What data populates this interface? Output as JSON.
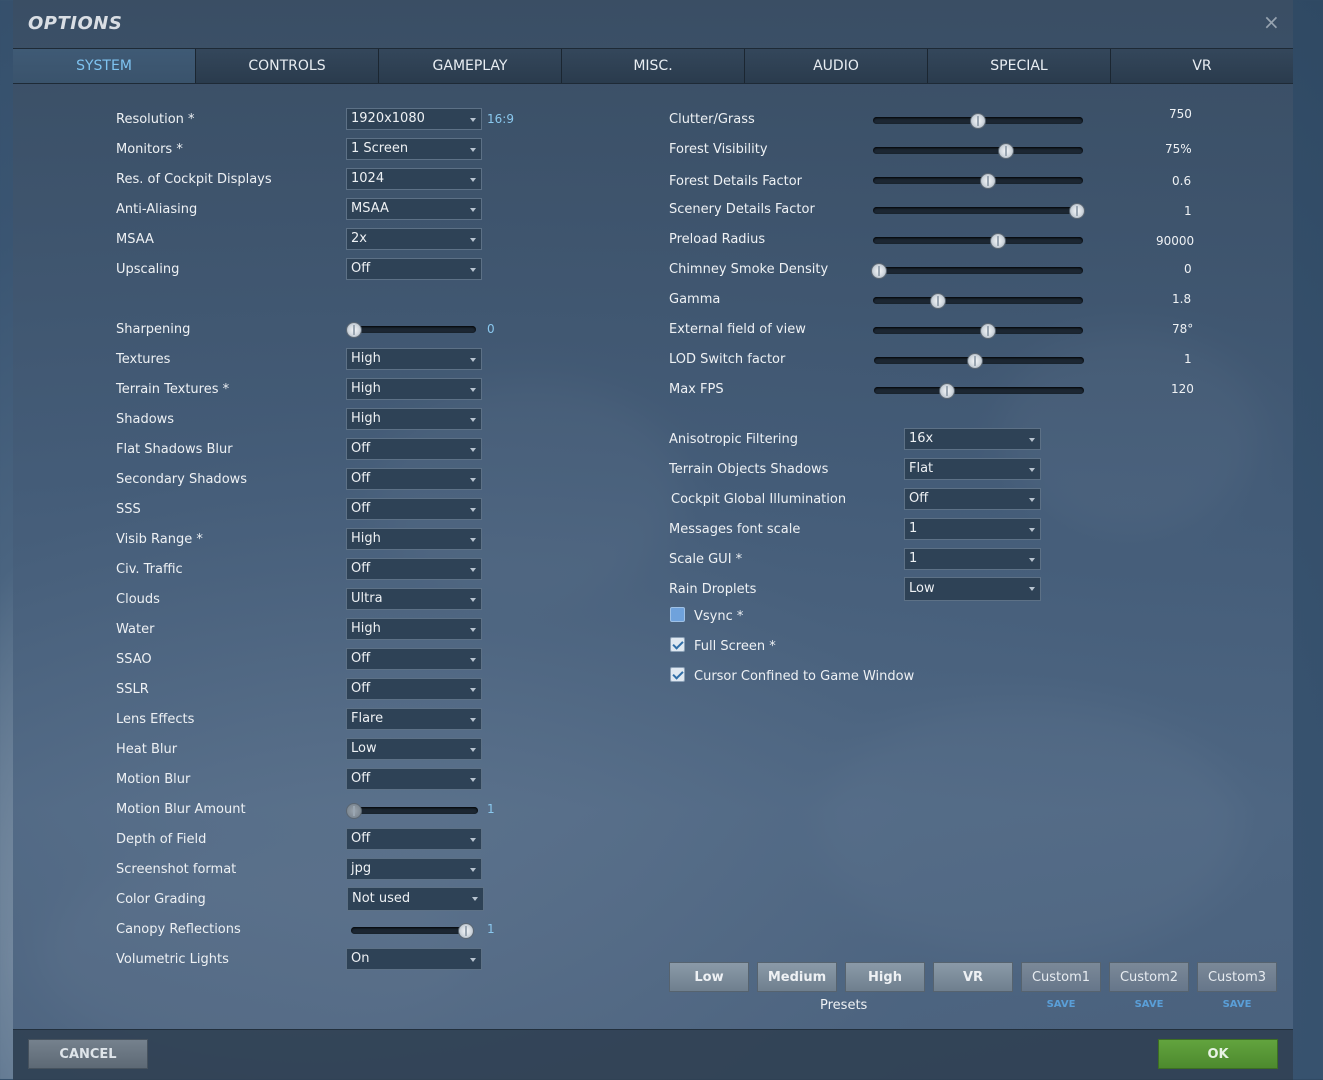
{
  "window": {
    "title": "OPTIONS"
  },
  "tabs": [
    "SYSTEM",
    "CONTROLS",
    "GAMEPLAY",
    "MISC.",
    "AUDIO",
    "SPECIAL",
    "VR"
  ],
  "active_tab": "SYSTEM",
  "left": {
    "resolution": {
      "label": "Resolution *",
      "value": "1920x1080",
      "aspect": "16:9"
    },
    "monitors": {
      "label": "Monitors *",
      "value": "1 Screen"
    },
    "cockpit_res": {
      "label": "Res. of Cockpit Displays",
      "value": "1024"
    },
    "anti_aliasing": {
      "label": "Anti-Aliasing",
      "value": "MSAA"
    },
    "msaa": {
      "label": "MSAA",
      "value": "2x"
    },
    "upscaling": {
      "label": "Upscaling",
      "value": "Off"
    },
    "sharpening": {
      "label": "Sharpening",
      "value": "0",
      "fraction": 0.0
    },
    "textures": {
      "label": "Textures",
      "value": "High"
    },
    "terrain_textures": {
      "label": "Terrain Textures *",
      "value": "High"
    },
    "shadows": {
      "label": "Shadows",
      "value": "High"
    },
    "flat_shadows_blur": {
      "label": "Flat Shadows Blur",
      "value": "Off"
    },
    "secondary_shadows": {
      "label": "Secondary Shadows",
      "value": "Off"
    },
    "sss": {
      "label": "SSS",
      "value": "Off"
    },
    "visib_range": {
      "label": "Visib Range *",
      "value": "High"
    },
    "civ_traffic": {
      "label": "Civ. Traffic",
      "value": "Off"
    },
    "clouds": {
      "label": "Clouds",
      "value": "Ultra"
    },
    "water": {
      "label": "Water",
      "value": "High"
    },
    "ssao": {
      "label": "SSAO",
      "value": "Off"
    },
    "sslr": {
      "label": "SSLR",
      "value": "Off"
    },
    "lens_effects": {
      "label": "Lens Effects",
      "value": "Flare"
    },
    "heat_blur": {
      "label": "Heat Blur",
      "value": "Low"
    },
    "motion_blur": {
      "label": "Motion Blur",
      "value": "Off"
    },
    "motion_blur_amount": {
      "label": "Motion Blur Amount",
      "value": "1",
      "fraction": 0.0
    },
    "depth_of_field": {
      "label": "Depth of Field",
      "value": "Off"
    },
    "screenshot_format": {
      "label": "Screenshot format",
      "value": "jpg"
    },
    "color_grading": {
      "label": "Color Grading",
      "value": "Not used"
    },
    "canopy_reflections": {
      "label": "Canopy Reflections",
      "value": "1",
      "fraction": 1.0
    },
    "volumetric_lights": {
      "label": "Volumetric Lights",
      "value": "On"
    }
  },
  "right": {
    "clutter": {
      "label": "Clutter/Grass",
      "value": "750",
      "fraction": 0.5
    },
    "forest_visibility": {
      "label": "Forest Visibility",
      "value": "75%",
      "fraction": 0.64
    },
    "forest_details": {
      "label": "Forest Details Factor",
      "value": "0.6",
      "fraction": 0.55
    },
    "scenery_details": {
      "label": "Scenery Details Factor",
      "value": "1",
      "fraction": 1.0
    },
    "preload_radius": {
      "label": "Preload Radius",
      "value": "90000",
      "fraction": 0.6
    },
    "chimney_smoke": {
      "label": "Chimney Smoke Density",
      "value": "0",
      "fraction": 0.0
    },
    "gamma": {
      "label": "Gamma",
      "value": "1.8",
      "fraction": 0.3
    },
    "external_fov": {
      "label": "External field of view",
      "value": "78°",
      "fraction": 0.55
    },
    "lod_switch": {
      "label": "LOD Switch factor",
      "value": "1",
      "fraction": 0.48
    },
    "max_fps": {
      "label": "Max FPS",
      "value": "120",
      "fraction": 0.34
    },
    "anisotropic": {
      "label": "Anisotropic Filtering",
      "value": "16x"
    },
    "terrain_object_shadows": {
      "label": "Terrain Objects Shadows",
      "value": "Flat"
    },
    "cockpit_gi": {
      "label": "Cockpit Global Illumination",
      "value": "Off"
    },
    "messages_font_scale": {
      "label": "Messages font scale",
      "value": "1"
    },
    "scale_gui": {
      "label": "Scale GUI *",
      "value": "1"
    },
    "rain_droplets": {
      "label": "Rain Droplets",
      "value": "Low"
    },
    "vsync": {
      "label": "Vsync *",
      "checked": false
    },
    "full_screen": {
      "label": "Full Screen *",
      "checked": true
    },
    "cursor_confined": {
      "label": "Cursor Confined to Game Window",
      "checked": true
    }
  },
  "presets": {
    "label": "Presets",
    "buttons": [
      "Low",
      "Medium",
      "High",
      "VR",
      "Custom1",
      "Custom2",
      "Custom3"
    ],
    "save_label": "SAVE"
  },
  "footer": {
    "cancel": "CANCEL",
    "ok": "OK"
  },
  "colors": {
    "accent_tab": "#7ec3f0",
    "ok_green": "#5a9a36",
    "save_blue": "#5a9fd8"
  }
}
